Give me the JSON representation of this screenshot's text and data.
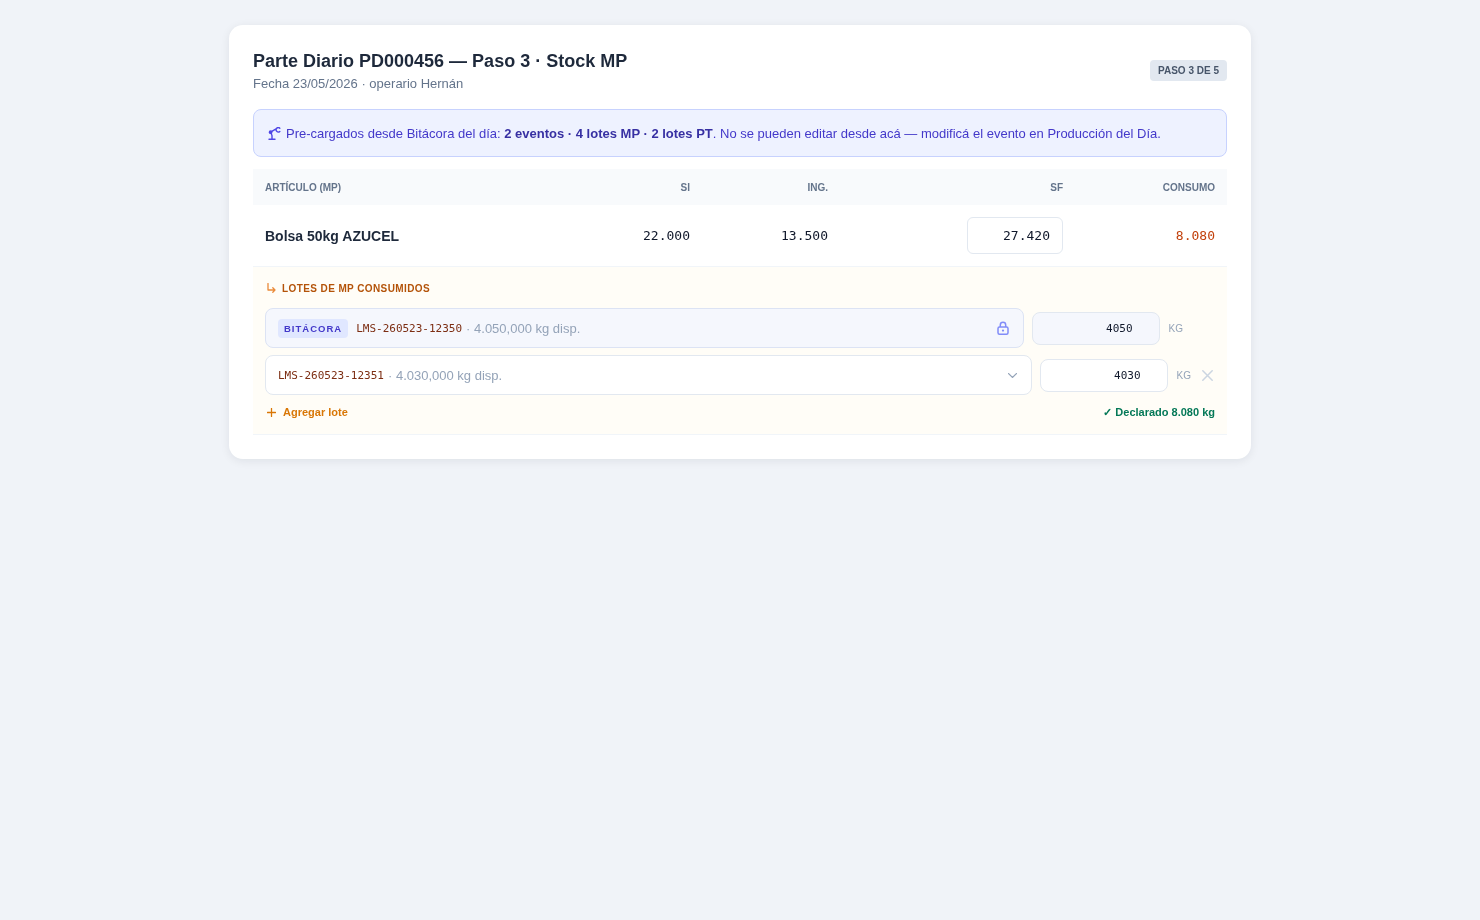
{
  "header": {
    "title": "Parte Diario PD000456 — Paso 3 · Stock MP",
    "subtitle": "Fecha 23/05/2026 · operario Hernán",
    "step_badge": "PASO 3 DE 5"
  },
  "notice": {
    "text": "Pre-cargados desde Bitácora del día: **2 eventos · 4 lotes MP · 2 lotes PT**. No se pueden editar desde acá — modificá el evento en Producción del Día."
  },
  "table": {
    "columns": [
      "ARTÍCULO (MP)",
      "SI",
      "ING.",
      "SF",
      "CONSUMO"
    ],
    "rows": [
      {
        "article": "Bolsa 50kg AZUCEL",
        "si": "22.000",
        "ing": "13.500",
        "sf": "27.420",
        "consumo": "8.080",
        "lots": {
          "title": "LOTES DE MP CONSUMIDOS",
          "items": [
            {
              "locked": true,
              "badge": "BITÁCORA",
              "code": "LMS-260523-12350",
              "available": "· 4.050,000 kg disp.",
              "quantity": "4050",
              "unit": "KG"
            },
            {
              "locked": false,
              "code": "LMS-260523-12351",
              "available": "· 4.030,000 kg disp.",
              "quantity": "4030",
              "unit": "KG"
            }
          ],
          "add_label": "Agregar lote",
          "declared": "✓ Declarado 8.080 kg"
        }
      }
    ]
  }
}
